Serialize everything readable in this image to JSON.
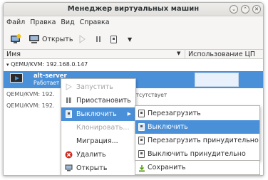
{
  "window": {
    "title": "Менеджер виртуальных машин"
  },
  "menubar": {
    "items": [
      "Файл",
      "Правка",
      "Вид",
      "Справка"
    ]
  },
  "toolbar": {
    "open_label": "Открыть"
  },
  "columns": {
    "name": "Имя",
    "cpu": "Использование ЦП"
  },
  "connections": [
    {
      "label": "QEMU/KVM: 192.168.0.147"
    },
    {
      "label": "QEMU/KVM: 192."
    },
    {
      "label": "QEMU/KVM: 192."
    }
  ],
  "vm": {
    "name": "alt-server",
    "status": "Работает"
  },
  "absent_text": "отсутствует",
  "context_menu": {
    "items": [
      {
        "label": "Запустить",
        "icon": "play-icon",
        "enabled": false
      },
      {
        "label": "Приостановить",
        "icon": "pause-icon",
        "enabled": true
      },
      {
        "label": "Выключить",
        "icon": "power-icon",
        "enabled": true,
        "submenu": true
      },
      {
        "label": "Клонировать...",
        "icon": "",
        "enabled": false
      },
      {
        "label": "Миграция...",
        "icon": "",
        "enabled": true
      },
      {
        "label": "Удалить",
        "icon": "delete-icon",
        "enabled": true
      },
      {
        "label": "Открыть",
        "icon": "open-icon",
        "enabled": true
      }
    ]
  },
  "shutdown_submenu": {
    "items": [
      {
        "label": "Перезагрузить"
      },
      {
        "label": "Выключить"
      },
      {
        "label": "Перезагрузить принудительно"
      },
      {
        "label": "Выключить принудительно"
      },
      {
        "label": "Сохранить"
      }
    ]
  },
  "colors": {
    "selection": "#4a90d9",
    "delete_red": "#cc2a1f",
    "save_green": "#4e9a06"
  }
}
